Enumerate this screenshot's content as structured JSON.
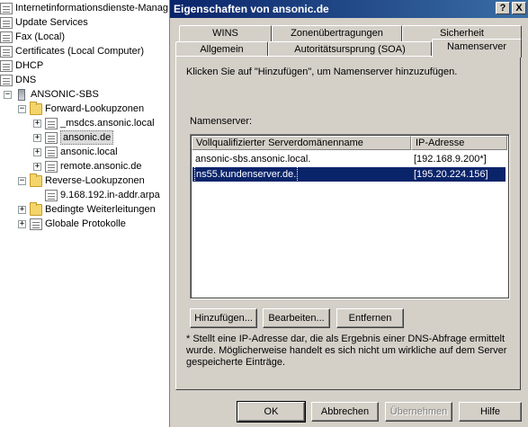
{
  "tree": {
    "items": [
      {
        "label": "Internetinformationsdienste-Manag",
        "level": 0,
        "icon": "iis-icon",
        "expander": ""
      },
      {
        "label": "Update Services",
        "level": 0,
        "icon": "update-services-icon",
        "expander": ""
      },
      {
        "label": "Fax (Local)",
        "level": 0,
        "icon": "fax-icon",
        "expander": ""
      },
      {
        "label": "Certificates (Local Computer)",
        "level": 0,
        "icon": "certificates-icon",
        "expander": ""
      },
      {
        "label": "DHCP",
        "level": 0,
        "icon": "dhcp-icon",
        "expander": ""
      },
      {
        "label": "DNS",
        "level": 0,
        "icon": "dns-icon",
        "expander": ""
      },
      {
        "label": "ANSONIC-SBS",
        "level": 1,
        "icon": "server-icon",
        "expander": "-"
      },
      {
        "label": "Forward-Lookupzonen",
        "level": 2,
        "icon": "folder-icon",
        "expander": "-"
      },
      {
        "label": "_msdcs.ansonic.local",
        "level": 3,
        "icon": "zone-icon",
        "expander": "+"
      },
      {
        "label": "ansonic.de",
        "level": 3,
        "icon": "zone-icon",
        "expander": "+",
        "selected": true
      },
      {
        "label": "ansonic.local",
        "level": 3,
        "icon": "zone-icon",
        "expander": "+"
      },
      {
        "label": "remote.ansonic.de",
        "level": 3,
        "icon": "zone-icon",
        "expander": "+"
      },
      {
        "label": "Reverse-Lookupzonen",
        "level": 2,
        "icon": "folder-icon",
        "expander": "-"
      },
      {
        "label": "9.168.192.in-addr.arpa",
        "level": 3,
        "icon": "zone-icon",
        "expander": ""
      },
      {
        "label": "Bedingte Weiterleitungen",
        "level": 2,
        "icon": "folder-icon",
        "expander": "+"
      },
      {
        "label": "Globale Protokolle",
        "level": 2,
        "icon": "log-icon",
        "expander": "+"
      }
    ]
  },
  "dialog": {
    "title": "Eigenschaften von ansonic.de",
    "help_button": "?",
    "close_button": "X",
    "tabs_back": [
      "WINS",
      "Zonenübertragungen",
      "Sicherheit"
    ],
    "tabs_front": [
      "Allgemein",
      "Autoritätsursprung (SOA)",
      "Namenserver"
    ],
    "active_tab": "Namenserver",
    "instruction": "Klicken Sie auf \"Hinzufügen\", um Namenserver hinzuzufügen.",
    "list_label": "Namenserver:",
    "columns": [
      "Vollqualifizierter Serverdomänenname",
      "IP-Adresse"
    ],
    "rows": [
      {
        "name": "ansonic-sbs.ansonic.local.",
        "ip": "[192.168.9.200*]",
        "selected": false
      },
      {
        "name": "ns55.kundenserver.de.",
        "ip": "[195.20.224.156]",
        "selected": true
      }
    ],
    "buttons": {
      "add": "Hinzufügen...",
      "edit": "Bearbeiten...",
      "remove": "Entfernen"
    },
    "footnote": "* Stellt eine IP-Adresse dar, die als Ergebnis einer DNS-Abfrage ermittelt wurde. Möglicherweise handelt es sich nicht um wirkliche auf dem Server gespeicherte Einträge.",
    "footer": {
      "ok": "OK",
      "cancel": "Abbrechen",
      "apply": "Übernehmen",
      "help": "Hilfe"
    }
  }
}
